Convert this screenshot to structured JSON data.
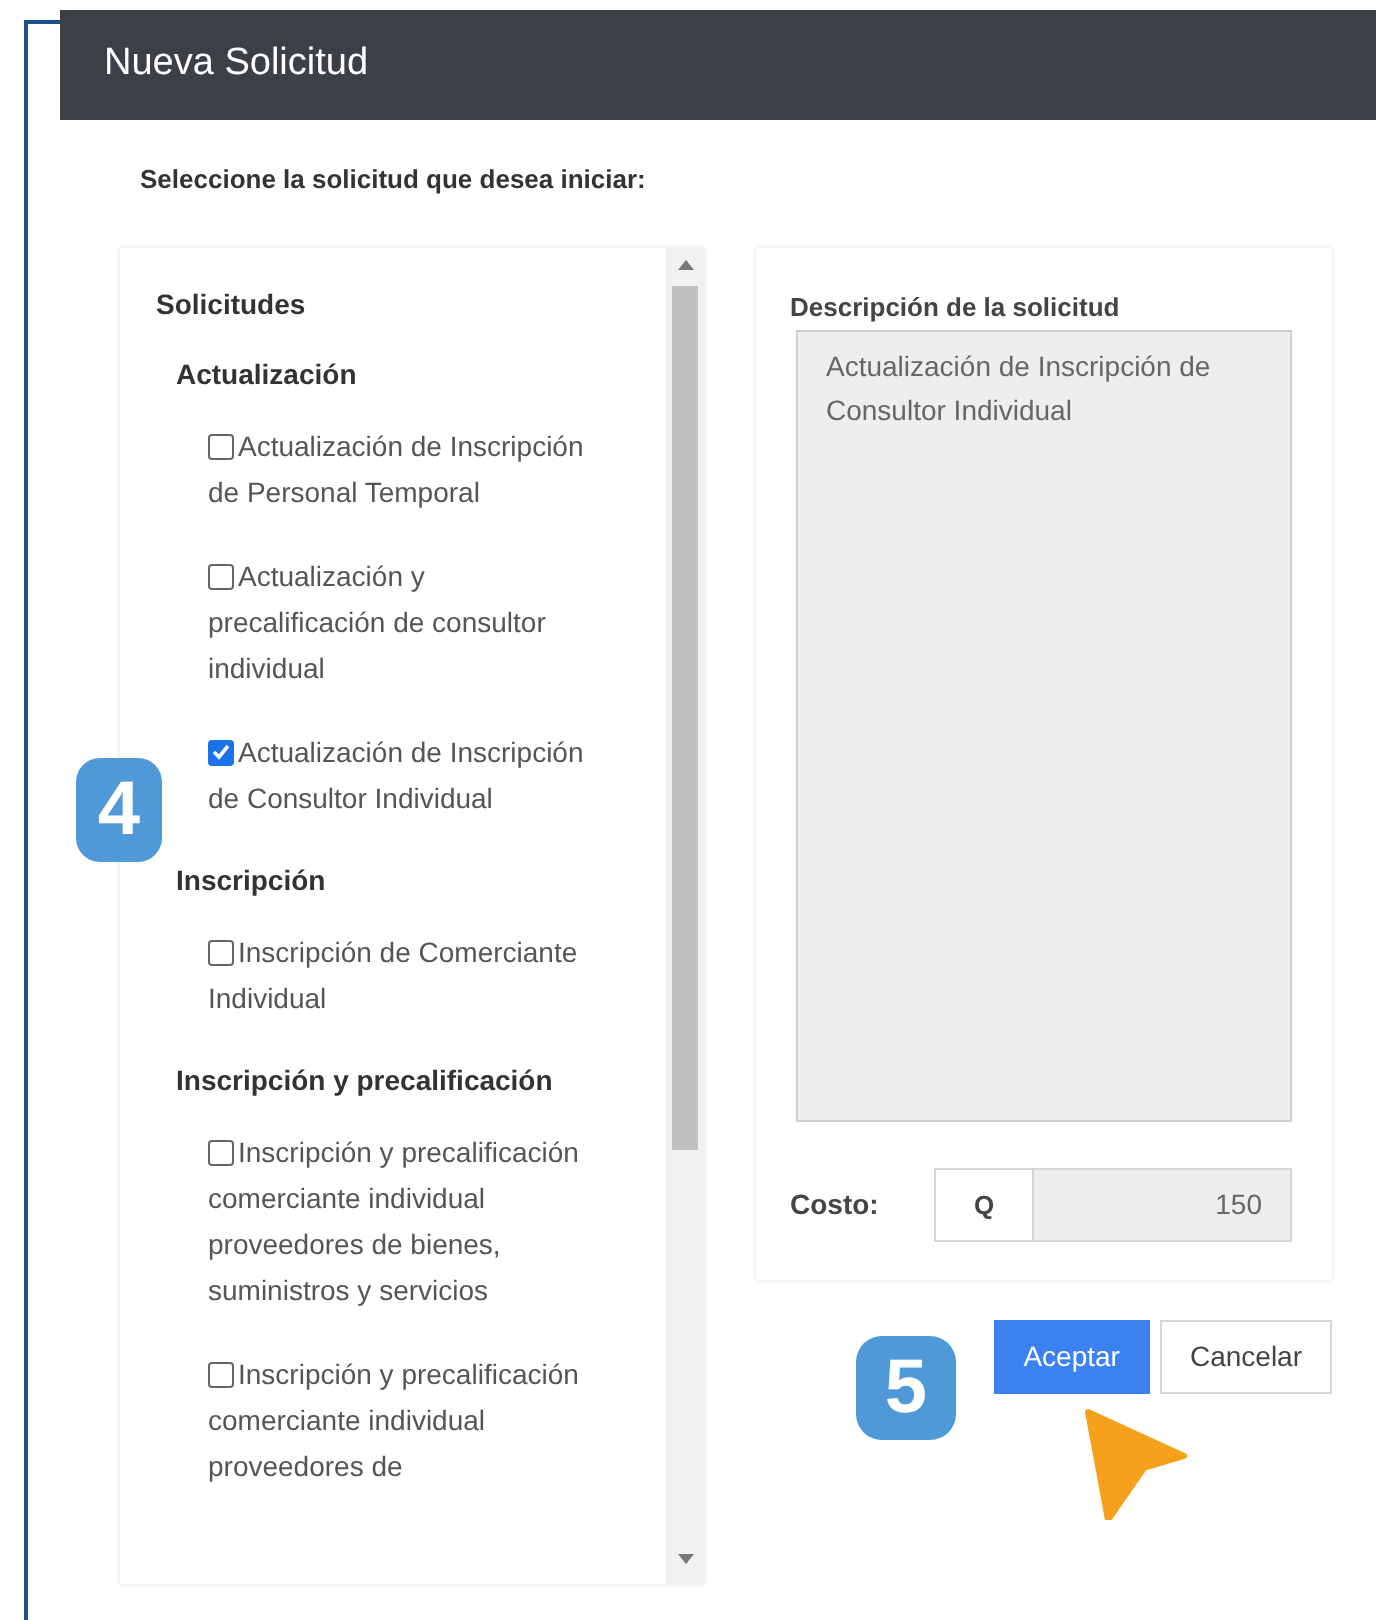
{
  "dialog": {
    "title": "Nueva Solicitud",
    "instruction": "Seleccione la solicitud que desea iniciar:",
    "list": {
      "heading": "Solicitudes",
      "groups": [
        {
          "label": "Actualización",
          "items": [
            {
              "label": "Actualización de Inscripción de Personal Temporal",
              "checked": false
            },
            {
              "label": "Actualización y precalificación de consultor individual",
              "checked": false
            },
            {
              "label": "Actualización de Inscripción de Consultor Individual",
              "checked": true
            }
          ]
        },
        {
          "label": "Inscripción",
          "items": [
            {
              "label": "Inscripción de Comerciante Individual",
              "checked": false
            }
          ]
        },
        {
          "label": "Inscripción y precalificación",
          "items": [
            {
              "label": "Inscripción y precalificación comerciante individual proveedores de bienes, suministros y servicios",
              "checked": false
            },
            {
              "label": "Inscripción y precalificación comerciante individual proveedores de",
              "checked": false
            }
          ]
        }
      ]
    },
    "description": {
      "label": "Descripción de la solicitud",
      "value": "Actualización de Inscripción de Consultor Individual"
    },
    "cost": {
      "label": "Costo:",
      "currency": "Q",
      "value": "150"
    },
    "buttons": [
      {
        "label": "Aceptar",
        "kind": "primary"
      },
      {
        "label": "Cancelar",
        "kind": "secondary"
      }
    ],
    "callouts": [
      {
        "label": "4"
      },
      {
        "label": "5"
      }
    ]
  }
}
